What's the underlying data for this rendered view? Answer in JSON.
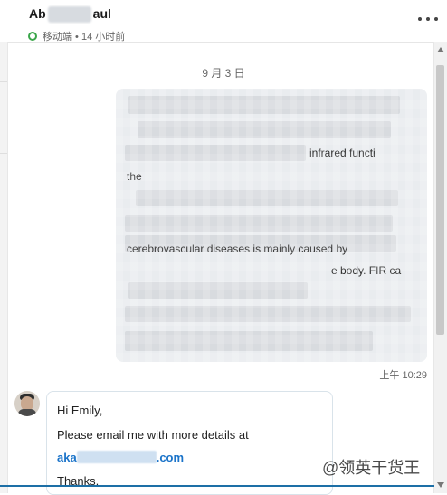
{
  "header": {
    "name_prefix": "Ab",
    "name_suffix": "aul",
    "presence": "移动端 • 14 小时前"
  },
  "conversation": {
    "date": "9 月 3 日",
    "outgoing": {
      "visible_fragments": [
        "infrared functi",
        "the",
        "cerebrovascular diseases is mainly caused by",
        "e body. FIR ca"
      ],
      "time": "上午 10:29"
    },
    "incoming": {
      "lines": [
        "Hi Emily,",
        "Please email me with more details at"
      ],
      "email_prefix": "aka",
      "email_suffix": ".com",
      "signoff": "Thanks,"
    }
  },
  "watermark": "@领英干货王",
  "colors": {
    "link": "#1a73c9",
    "presence": "#3aa64a",
    "outgoing_bubble": "#e9ecef",
    "accent_line": "#1d6fa6"
  }
}
